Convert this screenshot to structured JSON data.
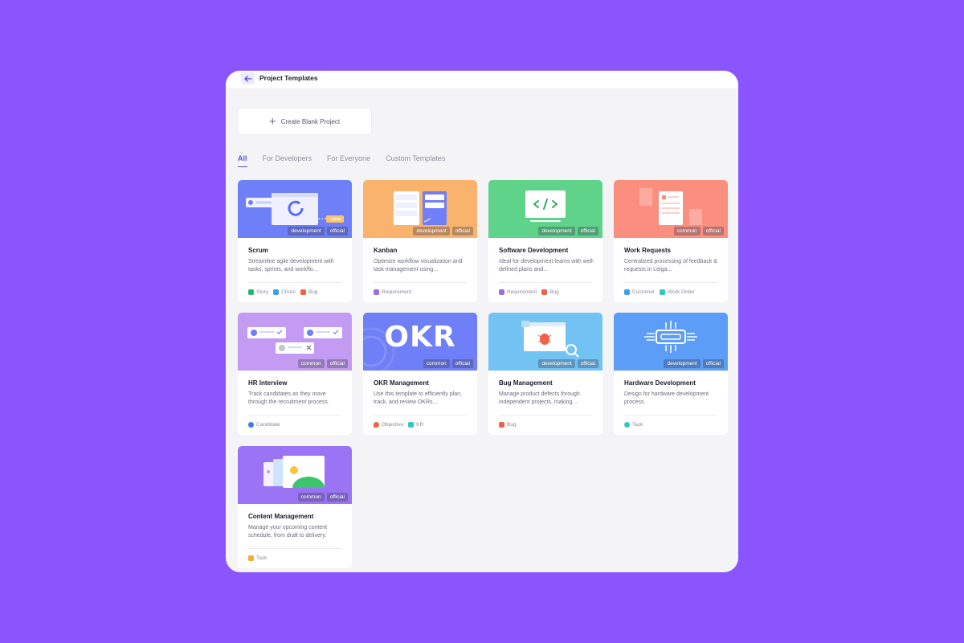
{
  "window": {
    "title": "Project Templates"
  },
  "blank_button": {
    "label": "Create Blank Project"
  },
  "tabs": [
    {
      "label": "All",
      "active": true
    },
    {
      "label": "For Developers",
      "active": false
    },
    {
      "label": "For Everyone",
      "active": false
    },
    {
      "label": "Custom Templates",
      "active": false
    }
  ],
  "cards": [
    {
      "title": "Scrum",
      "desc": "Streamline agile development with tasks, sprints, and workflo...",
      "badges": [
        "development",
        "official"
      ],
      "banner_color": "#6f7ff7",
      "tags": [
        {
          "label": "Story",
          "color": "#2bb673",
          "icon": "story-icon"
        },
        {
          "label": "Chore",
          "color": "#3aa0e6",
          "icon": "chore-icon"
        },
        {
          "label": "Bug",
          "color": "#f0604a",
          "icon": "bug-icon"
        }
      ]
    },
    {
      "title": "Kanban",
      "desc": "Optimize workflow visualization and task management using...",
      "badges": [
        "development",
        "official"
      ],
      "banner_color": "#f9b36c",
      "tags": [
        {
          "label": "Requirement",
          "color": "#9b6ee9",
          "icon": "requirement-icon"
        }
      ]
    },
    {
      "title": "Software Development",
      "desc": "Ideal for development teams with well-defined plans and...",
      "badges": [
        "development",
        "official"
      ],
      "banner_color": "#5fd38a",
      "tags": [
        {
          "label": "Requirement",
          "color": "#9b6ee9",
          "icon": "requirement-icon"
        },
        {
          "label": "Bug",
          "color": "#f0604a",
          "icon": "bug-icon"
        }
      ]
    },
    {
      "title": "Work Requests",
      "desc": "Centralized processing of feedback & requests in Leiga...",
      "badges": [
        "common",
        "official"
      ],
      "banner_color": "#fa8f80",
      "tags": [
        {
          "label": "Customer",
          "color": "#3aa0e6",
          "icon": "customer-icon"
        },
        {
          "label": "Work Order",
          "color": "#34c5c5",
          "icon": "work-order-icon"
        }
      ]
    },
    {
      "title": "HR Interview",
      "desc": "Track candidates as they move through the recruitment process.",
      "badges": [
        "common",
        "official"
      ],
      "banner_color": "#c39bf2",
      "tags": [
        {
          "label": "Candidate",
          "color": "#3a7be6",
          "icon": "candidate-icon"
        }
      ]
    },
    {
      "title": "OKR Management",
      "desc": "Use this template to efficiently plan, track, and review OKRs...",
      "badges": [
        "common",
        "official"
      ],
      "banner_color": "#6f7ff7",
      "banner_text": "OKR",
      "tags": [
        {
          "label": "Objective",
          "color": "#f0604a",
          "icon": "objective-icon"
        },
        {
          "label": "KR",
          "color": "#34c5c5",
          "icon": "kr-icon"
        }
      ]
    },
    {
      "title": "Bug Management",
      "desc": "Manage product defects through independent projects, making...",
      "badges": [
        "development",
        "official"
      ],
      "banner_color": "#72c3f4",
      "tags": [
        {
          "label": "Bug",
          "color": "#f0604a",
          "icon": "bug-icon"
        }
      ]
    },
    {
      "title": "Hardware Development",
      "desc": "Design for hardware development process.",
      "badges": [
        "development",
        "official"
      ],
      "banner_color": "#5b9df7",
      "tags": [
        {
          "label": "Task",
          "color": "#34c5c5",
          "icon": "task-icon"
        }
      ]
    },
    {
      "title": "Content Management",
      "desc": "Manage your upcoming content schedule, from draft to delivery.",
      "badges": [
        "common",
        "official"
      ],
      "banner_color": "#9a74f4",
      "tags": [
        {
          "label": "Task",
          "color": "#f3a93b",
          "icon": "task-icon"
        }
      ]
    }
  ]
}
